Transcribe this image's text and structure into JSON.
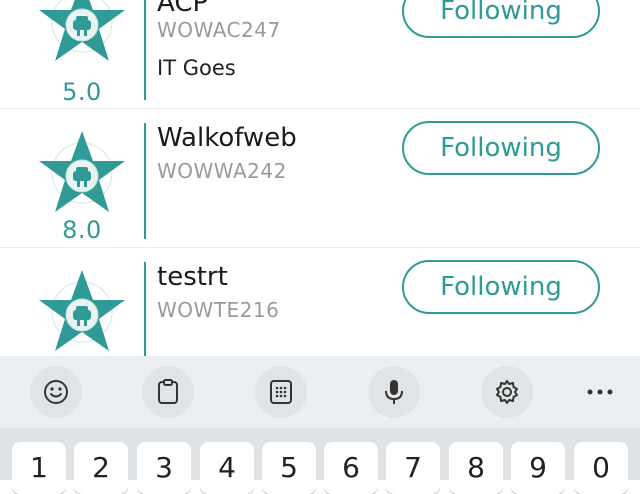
{
  "follow_list": [
    {
      "name": "ACP",
      "code": "WOWAC247",
      "description": "IT Goes",
      "rating": "5.0",
      "button": "Following"
    },
    {
      "name": "Walkofweb",
      "code": "WOWWA242",
      "description": "",
      "rating": "8.0",
      "button": "Following"
    },
    {
      "name": "testrt",
      "code": "WOWTE216",
      "description": "",
      "rating": "",
      "button": "Following"
    }
  ],
  "keyboard": {
    "toolbar_icons": [
      "emoji-icon",
      "clipboard-icon",
      "keypad-icon",
      "microphone-icon",
      "settings-icon",
      "more-icon"
    ],
    "keys": [
      "1",
      "2",
      "3",
      "4",
      "5",
      "6",
      "7",
      "8",
      "9",
      "0"
    ]
  },
  "colors": {
    "accent": "#2f9a96",
    "text": "#1b1b1b",
    "muted": "#9a9a9a",
    "toolbar_bg": "#eceff1",
    "keyboard_bg": "#dfe3e6"
  }
}
